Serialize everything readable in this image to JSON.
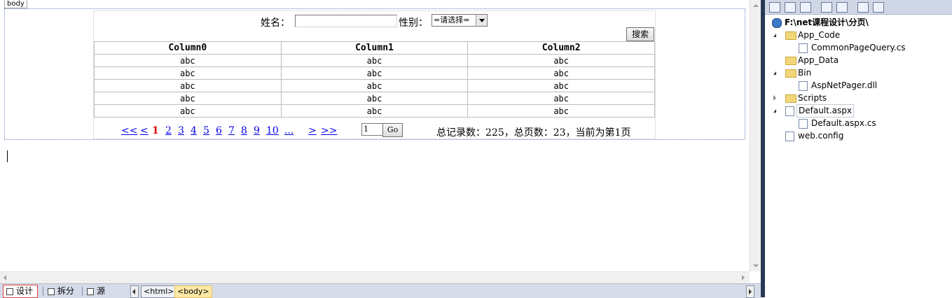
{
  "designer": {
    "body_tag": "body",
    "form": {
      "name_label": "姓名：",
      "name_value": "",
      "gender_label": "性别：",
      "gender_selected": "=请选择=",
      "search_button": "搜索"
    },
    "grid": {
      "columns": [
        "Column0",
        "Column1",
        "Column2"
      ],
      "rows": [
        [
          "abc",
          "abc",
          "abc"
        ],
        [
          "abc",
          "abc",
          "abc"
        ],
        [
          "abc",
          "abc",
          "abc"
        ],
        [
          "abc",
          "abc",
          "abc"
        ],
        [
          "abc",
          "abc",
          "abc"
        ]
      ]
    },
    "pager": {
      "first": "<<",
      "prev": "<",
      "current": "1",
      "pages": [
        "2",
        "3",
        "4",
        "5",
        "6",
        "7",
        "8",
        "9",
        "10"
      ],
      "more": "...",
      "next": ">",
      "last": ">>",
      "page_input": "1",
      "go_button": "Go",
      "summary": "总记录数：225，总页数：23，当前为第1页"
    }
  },
  "bottombar": {
    "tabs": [
      {
        "label": "设计",
        "active": true
      },
      {
        "label": "拆分",
        "active": false
      },
      {
        "label": "源",
        "active": false
      }
    ],
    "breadcrumbs": [
      {
        "label": "<html>",
        "selected": false
      },
      {
        "label": "<body>",
        "selected": true
      }
    ]
  },
  "solution_explorer": {
    "items": [
      {
        "label": "F:\\net课程设计\\分页\\",
        "level": 0,
        "icon": "project-icon",
        "expander": "none",
        "bold": true
      },
      {
        "label": "App_Code",
        "level": 1,
        "icon": "folder-icon",
        "expander": "open"
      },
      {
        "label": "CommonPageQuery.cs",
        "level": 2,
        "icon": "cs-file-icon",
        "expander": "none"
      },
      {
        "label": "App_Data",
        "level": 1,
        "icon": "folder-icon",
        "expander": "none"
      },
      {
        "label": "Bin",
        "level": 1,
        "icon": "folder-icon",
        "expander": "open"
      },
      {
        "label": "AspNetPager.dll",
        "level": 2,
        "icon": "dll-file-icon",
        "expander": "none"
      },
      {
        "label": "Scripts",
        "level": 1,
        "icon": "folder-icon",
        "expander": "closed"
      },
      {
        "label": "Default.aspx",
        "level": 1,
        "icon": "aspx-file-icon",
        "expander": "open",
        "selected": true
      },
      {
        "label": "Default.aspx.cs",
        "level": 2,
        "icon": "cs-file-icon",
        "expander": "none"
      },
      {
        "label": "web.config",
        "level": 1,
        "icon": "config-file-icon",
        "expander": "none"
      }
    ]
  },
  "colors": {
    "current_page": "#e00000",
    "link": "#0000ee",
    "splitter": "#293955"
  }
}
